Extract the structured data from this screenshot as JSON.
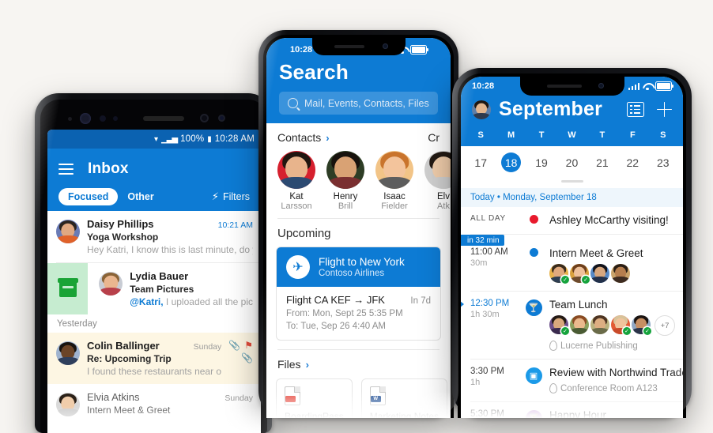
{
  "background_color": "#f7f5f2",
  "brand_color": "#0d7bd4",
  "left_phone": {
    "status": {
      "wifi_icon": "wifi-icon",
      "signal_icon": "signal-icon",
      "battery_text": "100%",
      "battery_icon": "battery-icon",
      "time": "10:28 AM"
    },
    "appbar": {
      "menu_icon": "hamburger-icon",
      "title": "Inbox",
      "focused_tab": "Focused",
      "other_tab": "Other",
      "filters_label": "Filters",
      "filters_icon": "bolt-icon"
    },
    "messages": [
      {
        "from": "Daisy Phillips",
        "subject": "Yoga Workshop",
        "preview": "Hey Katri, I know this is last minute, do yo...",
        "time": "10:21 AM",
        "time_style": "blue",
        "state": "unread"
      },
      {
        "from": "Lydia Bauer",
        "subject": "Team Pictures",
        "mention": "@Katri,",
        "preview": " I uploaded all the pic",
        "state": "swiped",
        "swipe_action": "archive"
      }
    ],
    "section_header": "Yesterday",
    "messages_2": [
      {
        "from": "Colin Ballinger",
        "subject": "Re: Upcoming Trip",
        "preview": "I found these restaurants near our...",
        "time": "Sunday",
        "icons": [
          "paperclip-icon",
          "flag-icon",
          "paperclip-icon"
        ],
        "state": "flagged"
      },
      {
        "from": "Elvia Atkins",
        "subject": "Intern Meet & Greet",
        "time": "Sunday",
        "state": "read"
      }
    ]
  },
  "mid_phone": {
    "status": {
      "time": "10:28",
      "signal_icon": "signal-icon",
      "wifi_icon": "wifi-icon",
      "battery_icon": "battery-icon"
    },
    "title": "Search",
    "search": {
      "icon": "search-icon",
      "placeholder": "Mail, Events, Contacts, Files"
    },
    "contacts_header": {
      "label": "Contacts",
      "chevron": "chevron-right-icon"
    },
    "contacts": [
      {
        "first": "Kat",
        "last": "Larsson"
      },
      {
        "first": "Henry",
        "last": "Brill"
      },
      {
        "first": "Isaac",
        "last": "Fielder"
      },
      {
        "first": "Elv",
        "last": "Atk"
      }
    ],
    "cut_off_header": "Cr",
    "upcoming_header": "Upcoming",
    "flight": {
      "icon": "airplane-icon",
      "title": "Flight to New York",
      "airline": "Contoso Airlines",
      "route": "Flight CA KEF → JFK",
      "countdown": "In 7d",
      "from": "From: Mon, Sept 25 5:35 PM",
      "to": "To: Tue, Sep 26 4:40 AM"
    },
    "files_header": {
      "label": "Files",
      "chevron": "chevron-right-icon"
    },
    "files": [
      {
        "name": "BoardingPass",
        "icon": "pdf-file-icon",
        "badge": "",
        "badge_color": "#e8544a"
      },
      {
        "name": "Marketing Notes",
        "icon": "word-file-icon",
        "badge": "W",
        "badge_color": "#2b579a"
      }
    ]
  },
  "right_phone": {
    "status": {
      "time": "10:28",
      "signal_icon": "signal-icon",
      "wifi_icon": "wifi-icon",
      "battery_icon": "battery-icon"
    },
    "header": {
      "avatar": "user-avatar",
      "month": "September",
      "agenda_icon": "agenda-view-icon",
      "add_icon": "plus-icon"
    },
    "day_initials": [
      "S",
      "M",
      "T",
      "W",
      "T",
      "F",
      "S"
    ],
    "dates": [
      {
        "n": "17",
        "selected": false
      },
      {
        "n": "18",
        "selected": true
      },
      {
        "n": "19",
        "selected": false
      },
      {
        "n": "20",
        "selected": false
      },
      {
        "n": "21",
        "selected": false
      },
      {
        "n": "22",
        "selected": false
      },
      {
        "n": "23",
        "selected": false
      }
    ],
    "today_label": "Today • Monday, September 18",
    "events": [
      {
        "time": "ALL DAY",
        "duration": "",
        "title": "Ashley McCarthy visiting!",
        "marker": "dot",
        "marker_color": "#e8192c",
        "location": "",
        "badge": "",
        "attendees": 0
      },
      {
        "time": "11:00 AM",
        "duration": "30m",
        "title": "Intern Meet & Greet",
        "marker": "dot",
        "marker_color": "#0d7bd4",
        "location": "",
        "badge": "in 32 min",
        "attendees": 4,
        "accepted": [
          true,
          true,
          false,
          false
        ]
      },
      {
        "time": "12:30 PM",
        "duration": "1h 30m",
        "title": "Team Lunch",
        "marker": "icon",
        "marker_icon": "cocktail-icon",
        "marker_color": "#0d7bd4",
        "location": "Lucerne Publishing",
        "location_icon": "location-pin-icon",
        "attendees": 5,
        "accepted": [
          true,
          false,
          false,
          true,
          true
        ],
        "more": "+7",
        "is_now": true
      },
      {
        "time": "3:30 PM",
        "duration": "1h",
        "title": "Review with Northwind Traders",
        "marker": "icon",
        "marker_icon": "presentation-icon",
        "marker_color": "#1b9ae8",
        "location": "Conference Room A123",
        "location_icon": "location-pin-icon",
        "attendees": 0
      },
      {
        "time": "5:30 PM",
        "duration": "",
        "title": "Happy Hour",
        "marker": "icon",
        "marker_icon": "cocktail-icon",
        "marker_color": "#c79ed8",
        "location": "",
        "attendees": 0
      }
    ]
  }
}
